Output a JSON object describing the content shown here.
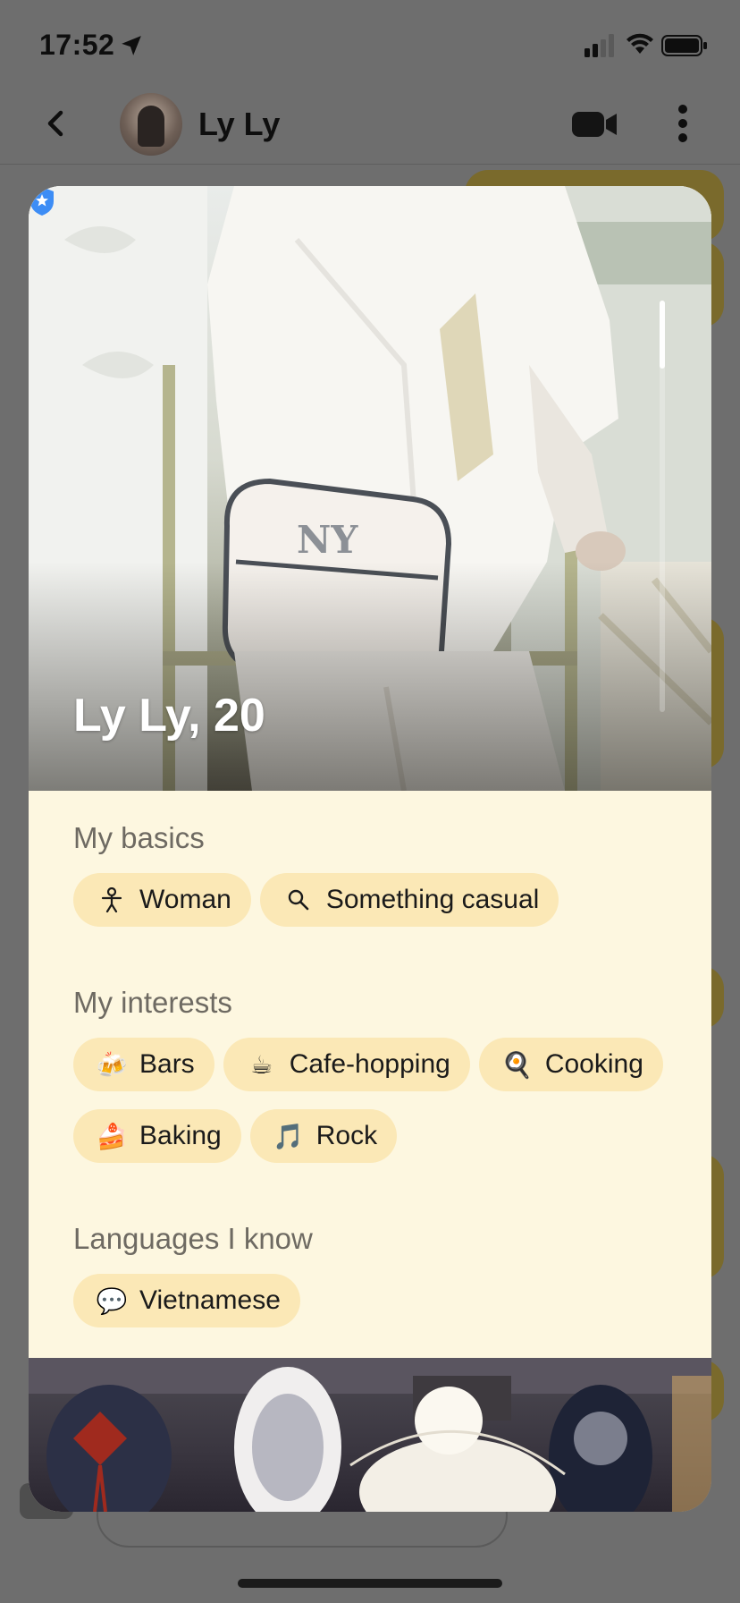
{
  "status_bar": {
    "time": "17:52"
  },
  "chat_header": {
    "name": "Ly Ly"
  },
  "profile": {
    "title": "Ly Ly, 20",
    "verified": true,
    "sections": {
      "basics": {
        "title": "My basics",
        "chips": [
          {
            "icon": "person-icon",
            "label": "Woman"
          },
          {
            "icon": "magnifier-icon",
            "label": "Something casual"
          }
        ]
      },
      "interests": {
        "title": "My interests",
        "chips": [
          {
            "icon": "beer-mugs-emoji",
            "glyph": "🍻",
            "label": "Bars"
          },
          {
            "icon": "hot-coffee-emoji",
            "glyph": "☕",
            "label": "Cafe-hopping"
          },
          {
            "icon": "frying-pan-egg-emoji",
            "glyph": "🍳",
            "label": "Cooking"
          },
          {
            "icon": "cake-slice-emoji",
            "glyph": "🍰",
            "label": "Baking"
          },
          {
            "icon": "music-note-emoji",
            "glyph": "🎵",
            "label": "Rock"
          }
        ]
      },
      "languages": {
        "title": "Languages I know",
        "chips": [
          {
            "icon": "speech-bubble-emoji",
            "glyph": "💬",
            "label": "Vietnamese"
          }
        ]
      }
    }
  },
  "colors": {
    "overlay_dim": "#6e6e6e",
    "card_background": "#fdf7e0",
    "chip_background": "#fbe8b6",
    "section_title": "#6e6a62",
    "verified_badge": "#3d8df5"
  }
}
